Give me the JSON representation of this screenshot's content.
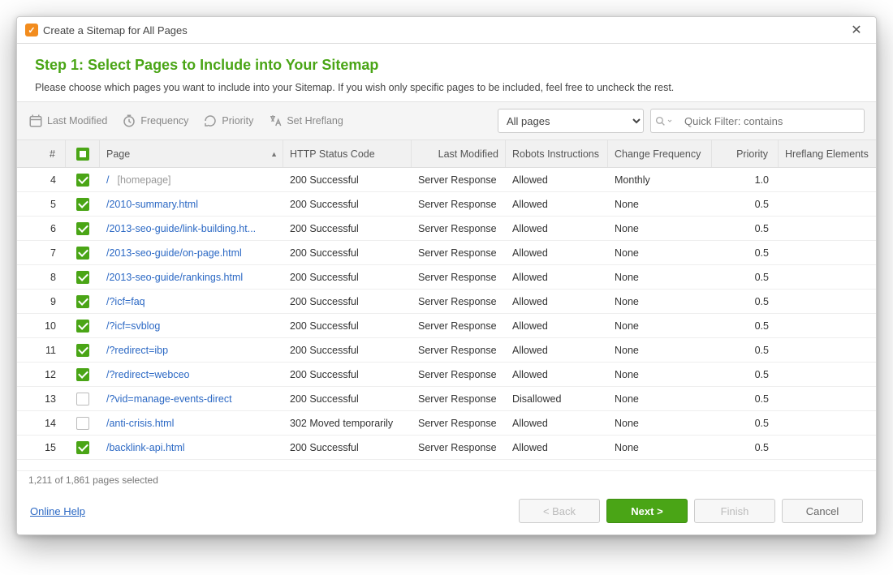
{
  "window": {
    "title": "Create a Sitemap for All Pages"
  },
  "step": {
    "title": "Step 1: Select Pages to Include into Your Sitemap",
    "description": "Please choose which pages you want to include into your Sitemap. If you wish only specific pages to be included, feel free to uncheck the rest."
  },
  "toolbar": {
    "last_modified": "Last Modified",
    "frequency": "Frequency",
    "priority": "Priority",
    "set_hreflang": "Set Hreflang",
    "pages_filter_selected": "All pages",
    "search_placeholder": "Quick Filter: contains"
  },
  "table": {
    "headers": {
      "num": "#",
      "page": "Page",
      "status": "HTTP Status Code",
      "last_modified": "Last Modified",
      "robots": "Robots Instructions",
      "frequency": "Change Frequency",
      "priority": "Priority",
      "hreflang": "Hreflang Elements"
    },
    "rows": [
      {
        "num": 4,
        "checked": true,
        "page": "/",
        "homepage": "[homepage]",
        "status": "200 Successful",
        "last_modified": "Server Response",
        "robots": "Allowed",
        "frequency": "Monthly",
        "priority": "1.0",
        "hreflang": ""
      },
      {
        "num": 5,
        "checked": true,
        "page": "/2010-summary.html",
        "status": "200 Successful",
        "last_modified": "Server Response",
        "robots": "Allowed",
        "frequency": "None",
        "priority": "0.5",
        "hreflang": ""
      },
      {
        "num": 6,
        "checked": true,
        "page": "/2013-seo-guide/link-building.ht...",
        "status": "200 Successful",
        "last_modified": "Server Response",
        "robots": "Allowed",
        "frequency": "None",
        "priority": "0.5",
        "hreflang": ""
      },
      {
        "num": 7,
        "checked": true,
        "page": "/2013-seo-guide/on-page.html",
        "status": "200 Successful",
        "last_modified": "Server Response",
        "robots": "Allowed",
        "frequency": "None",
        "priority": "0.5",
        "hreflang": ""
      },
      {
        "num": 8,
        "checked": true,
        "page": "/2013-seo-guide/rankings.html",
        "status": "200 Successful",
        "last_modified": "Server Response",
        "robots": "Allowed",
        "frequency": "None",
        "priority": "0.5",
        "hreflang": ""
      },
      {
        "num": 9,
        "checked": true,
        "page": "/?icf=faq",
        "status": "200 Successful",
        "last_modified": "Server Response",
        "robots": "Allowed",
        "frequency": "None",
        "priority": "0.5",
        "hreflang": ""
      },
      {
        "num": 10,
        "checked": true,
        "page": "/?icf=svblog",
        "status": "200 Successful",
        "last_modified": "Server Response",
        "robots": "Allowed",
        "frequency": "None",
        "priority": "0.5",
        "hreflang": ""
      },
      {
        "num": 11,
        "checked": true,
        "page": "/?redirect=ibp",
        "status": "200 Successful",
        "last_modified": "Server Response",
        "robots": "Allowed",
        "frequency": "None",
        "priority": "0.5",
        "hreflang": ""
      },
      {
        "num": 12,
        "checked": true,
        "page": "/?redirect=webceo",
        "status": "200 Successful",
        "last_modified": "Server Response",
        "robots": "Allowed",
        "frequency": "None",
        "priority": "0.5",
        "hreflang": ""
      },
      {
        "num": 13,
        "checked": false,
        "page": "/?vid=manage-events-direct",
        "status": "200 Successful",
        "last_modified": "Server Response",
        "robots": "Disallowed",
        "frequency": "None",
        "priority": "0.5",
        "hreflang": ""
      },
      {
        "num": 14,
        "checked": false,
        "page": "/anti-crisis.html",
        "status": "302 Moved temporarily",
        "last_modified": "Server Response",
        "robots": "Allowed",
        "frequency": "None",
        "priority": "0.5",
        "hreflang": ""
      },
      {
        "num": 15,
        "checked": true,
        "page": "/backlink-api.html",
        "status": "200 Successful",
        "last_modified": "Server Response",
        "robots": "Allowed",
        "frequency": "None",
        "priority": "0.5",
        "hreflang": ""
      }
    ]
  },
  "status_line": "1,211 of 1,861 pages selected",
  "footer": {
    "help": "Online Help",
    "back": "< Back",
    "next": "Next >",
    "finish": "Finish",
    "cancel": "Cancel"
  }
}
